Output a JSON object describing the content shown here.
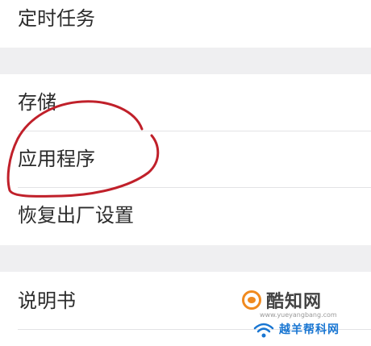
{
  "settings": {
    "group1": [
      {
        "label": "定时任务"
      }
    ],
    "group2": [
      {
        "label": "存储"
      },
      {
        "label": "应用程序"
      },
      {
        "label": "恢复出厂设置"
      }
    ],
    "group3": [
      {
        "label": "说明书"
      }
    ]
  },
  "annotation": {
    "type": "hand-drawn circle",
    "target": "应用程序",
    "color": "#c0202a"
  },
  "watermarks": {
    "primary": {
      "text": "酷知网",
      "icon": "kuzhi-logo-icon",
      "accent": "#f08a1f"
    },
    "secondary": {
      "url": "www.yueyangbang.com",
      "text": "越羊帮科网",
      "icon": "wifi-icon",
      "accent": "#1976d2"
    }
  }
}
